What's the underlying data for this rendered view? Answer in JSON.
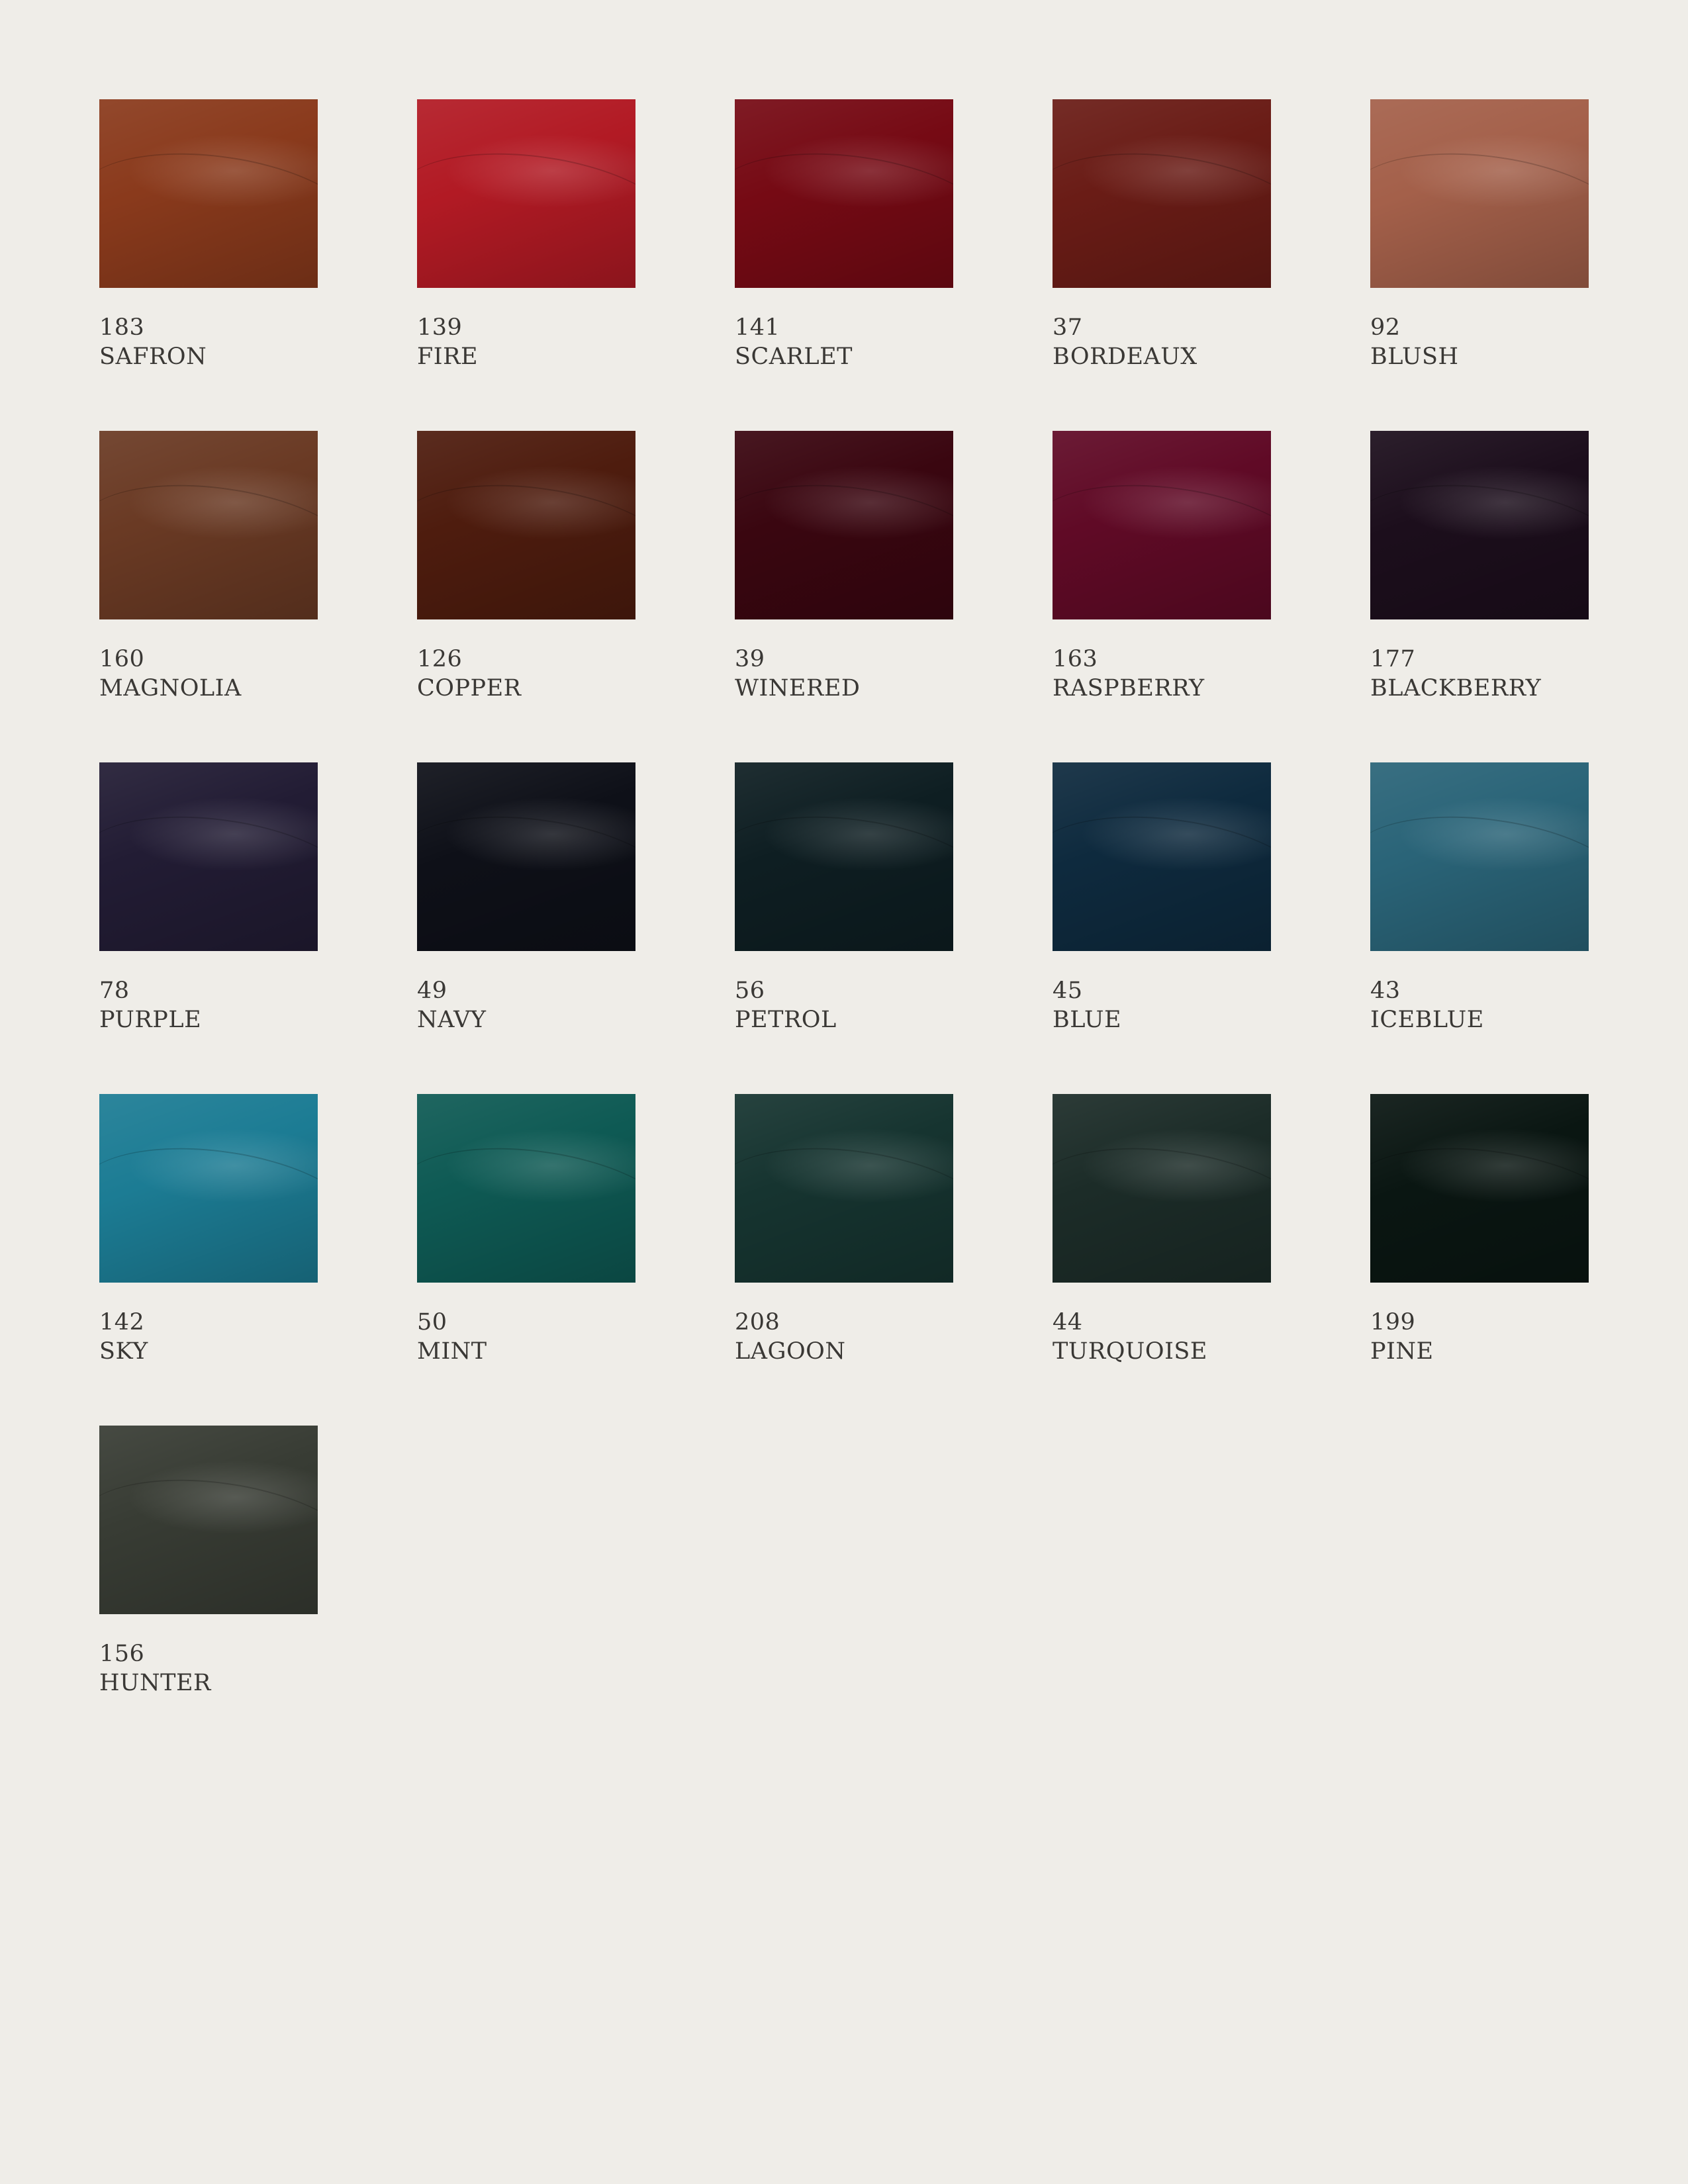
{
  "swatches": [
    {
      "number": "183",
      "name": "SAFRON",
      "color": "#8a3a1c",
      "icon": "fabric-swatch-safron"
    },
    {
      "number": "139",
      "name": "FIRE",
      "color": "#b21a24",
      "icon": "fabric-swatch-fire"
    },
    {
      "number": "141",
      "name": "SCARLET",
      "color": "#760a14",
      "icon": "fabric-swatch-scarlet"
    },
    {
      "number": "37",
      "name": "BORDEAUX",
      "color": "#6a1c16",
      "icon": "fabric-swatch-bordeaux"
    },
    {
      "number": "92",
      "name": "BLUSH",
      "color": "#a4604a",
      "icon": "fabric-swatch-blush"
    },
    {
      "number": "160",
      "name": "MAGNOLIA",
      "color": "#6a3a24",
      "icon": "fabric-swatch-magnolia"
    },
    {
      "number": "126",
      "name": "COPPER",
      "color": "#4e1c0e",
      "icon": "fabric-swatch-copper"
    },
    {
      "number": "39",
      "name": "WINERED",
      "color": "#3a0610",
      "icon": "fabric-swatch-winered"
    },
    {
      "number": "163",
      "name": "RASPBERRY",
      "color": "#600a26",
      "icon": "fabric-swatch-raspberry"
    },
    {
      "number": "177",
      "name": "BLACKBERRY",
      "color": "#1c0e1c",
      "icon": "fabric-swatch-blackberry"
    },
    {
      "number": "78",
      "name": "PURPLE",
      "color": "#221c34",
      "icon": "fabric-swatch-purple"
    },
    {
      "number": "49",
      "name": "NAVY",
      "color": "#0e1018",
      "icon": "fabric-swatch-navy"
    },
    {
      "number": "56",
      "name": "PETROL",
      "color": "#0e1e22",
      "icon": "fabric-swatch-petrol"
    },
    {
      "number": "45",
      "name": "BLUE",
      "color": "#0e2a3e",
      "icon": "fabric-swatch-blue"
    },
    {
      "number": "43",
      "name": "ICEBLUE",
      "color": "#2a6478",
      "icon": "fabric-swatch-iceblue"
    },
    {
      "number": "142",
      "name": "SKY",
      "color": "#1c7c94",
      "icon": "fabric-swatch-sky"
    },
    {
      "number": "50",
      "name": "MINT",
      "color": "#0e5a54",
      "icon": "fabric-swatch-mint"
    },
    {
      "number": "208",
      "name": "LAGOON",
      "color": "#163430",
      "icon": "fabric-swatch-lagoon"
    },
    {
      "number": "44",
      "name": "TURQUOISE",
      "color": "#1c2c28",
      "icon": "fabric-swatch-turquoise"
    },
    {
      "number": "199",
      "name": "PINE",
      "color": "#0a1612",
      "icon": "fabric-swatch-pine"
    },
    {
      "number": "156",
      "name": "HUNTER",
      "color": "#383c34",
      "icon": "fabric-swatch-hunter"
    }
  ]
}
